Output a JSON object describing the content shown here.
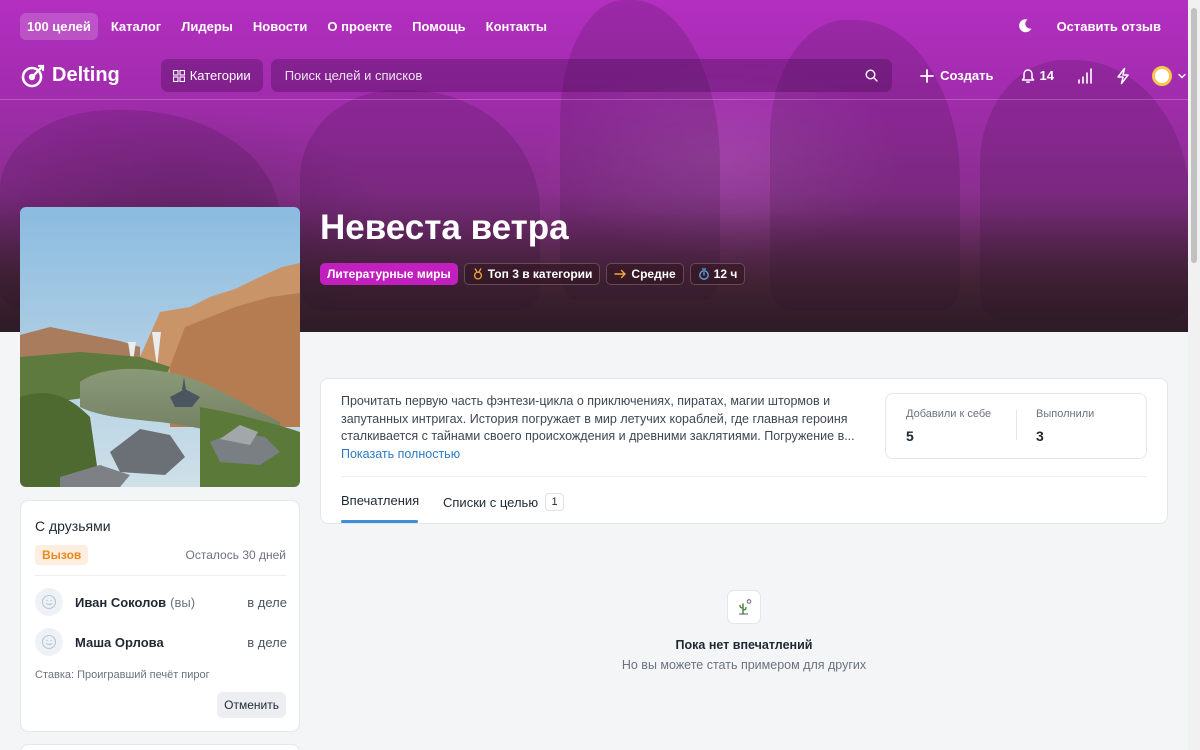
{
  "topnav": {
    "items": [
      {
        "label": "100 целей",
        "active": true
      },
      {
        "label": "Каталог"
      },
      {
        "label": "Лидеры"
      },
      {
        "label": "Новости"
      },
      {
        "label": "О проекте"
      },
      {
        "label": "Помощь"
      },
      {
        "label": "Контакты"
      }
    ],
    "theme_icon": "moon-icon",
    "feedback_label": "Оставить отзыв"
  },
  "header": {
    "logo_text": "Delting",
    "categories_label": "Категории",
    "search_placeholder": "Поиск целей и списков",
    "create_label": "Создать",
    "notifications_count": "14"
  },
  "goal": {
    "title": "Невеста ветра",
    "badges": {
      "category": "Литературные миры",
      "top": "Топ 3 в категории",
      "difficulty": "Средне",
      "time": "12 ч"
    },
    "description": "Прочитать первую часть фэнтези-цикла о приключениях, пиратах, магии штормов и запутанных интригах. История погружает в мир летучих кораблей, где главная героиня сталкивается с тайнами своего происхождения и древними заклятиями. Погружение в...",
    "show_full_label": "Показать полностью",
    "stats": {
      "added_label": "Добавили к себе",
      "added_value": "5",
      "completed_label": "Выполнили",
      "completed_value": "3"
    },
    "tabs": {
      "impressions": "Впечатления",
      "lists": "Списки с целью",
      "lists_count": "1"
    }
  },
  "friends": {
    "title": "С друзьями",
    "challenge_label": "Вызов",
    "remaining": "Осталось 30 дней",
    "members": [
      {
        "name": "Иван Соколов",
        "you_label": "(вы)",
        "status": "в деле"
      },
      {
        "name": "Маша Орлова",
        "status": "в деле"
      }
    ],
    "bet": "Ставка: Проигравший печёт пирог",
    "cancel_label": "Отменить"
  },
  "empty_state": {
    "title": "Пока нет впечатлений",
    "subtitle": "Но вы можете стать примером для других"
  },
  "colors": {
    "brand_magenta": "#c21fbf",
    "link_blue": "#2a7bc4",
    "challenge_orange": "#e8891b",
    "tab_active": "#3b8fd9"
  }
}
